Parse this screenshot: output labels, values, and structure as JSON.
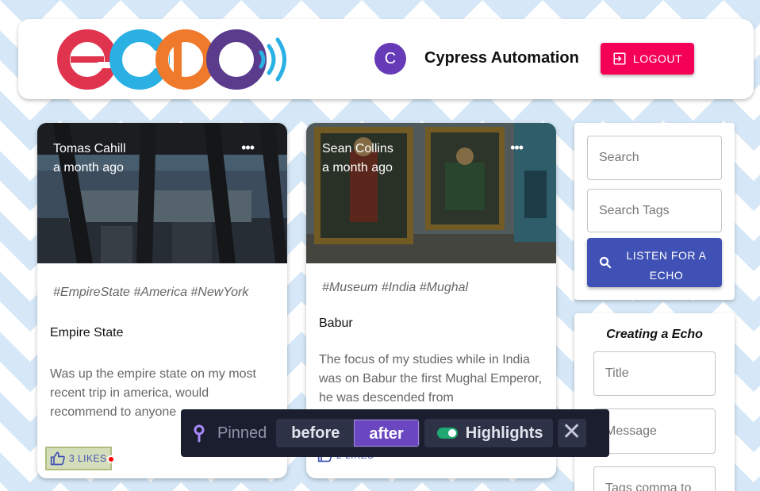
{
  "header": {
    "avatar_letter": "C",
    "username": "Cypress Automation",
    "logout_label": "LOGOUT"
  },
  "cards": [
    {
      "author": "Tomas Cahill",
      "time": "a month ago",
      "tags": "#EmpireState #America #NewYork",
      "title": "Empire State",
      "message": "Was up the empire state on my most recent trip in america, would recommend to anyone",
      "likes": "3 LIKES",
      "more": "•••"
    },
    {
      "author": "Sean Collins",
      "time": "a month ago",
      "tags": "#Museum #India #Mughal",
      "title": "Babur",
      "message": "The focus of my studies while in India was on Babur the first Mughal Emperor, he was descended from",
      "likes": "2 LIKES",
      "more": "•••"
    }
  ],
  "search": {
    "search_placeholder": "Search",
    "tags_placeholder": "Search Tags",
    "listen_label": "LISTEN FOR A ECHO"
  },
  "create": {
    "heading": "Creating a Echo",
    "title_placeholder": "Title",
    "message_placeholder": "Message",
    "tags_placeholder": "Tags comma to"
  },
  "pinbar": {
    "pinned_label": "Pinned",
    "before_label": "before",
    "after_label": "after",
    "highlights_label": "Highlights",
    "close_glyph": "✕"
  },
  "colors": {
    "logo_red": "#e0334d",
    "logo_blue": "#2ab0e3",
    "logo_orange": "#f07a2c",
    "logo_purple": "#5a3b8c",
    "logout_pink": "#f50057",
    "primary_indigo": "#3f51b5",
    "avatar_purple": "#673ab7"
  }
}
